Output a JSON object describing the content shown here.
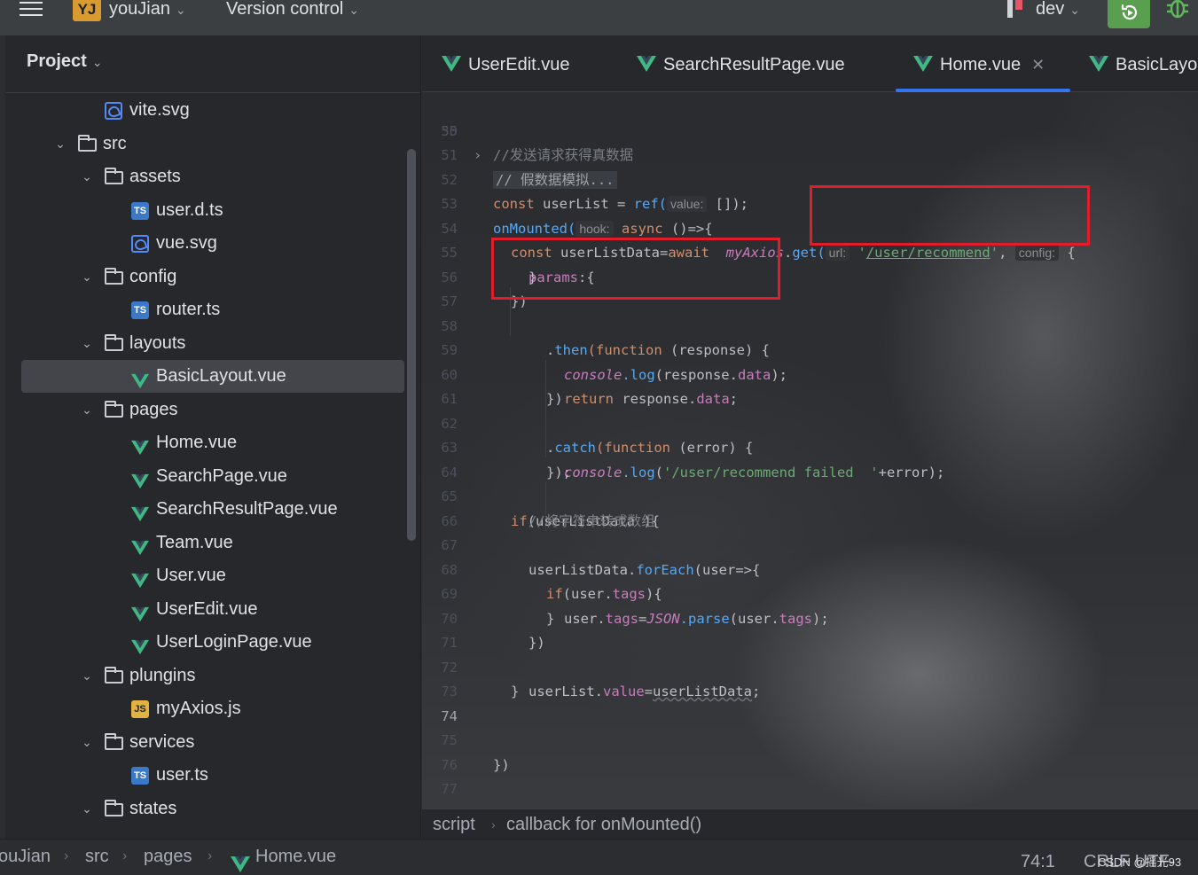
{
  "titlebar": {
    "project_badge": "YJ",
    "project_name": "youJian",
    "vcs_label": "Version control",
    "branch": "dev"
  },
  "project_panel": {
    "title": "Project",
    "items": [
      {
        "label": "vite.svg",
        "type": "svg"
      },
      {
        "label": "src",
        "type": "folder"
      },
      {
        "label": "assets",
        "type": "folder"
      },
      {
        "label": "user.d.ts",
        "type": "ts"
      },
      {
        "label": "vue.svg",
        "type": "svg"
      },
      {
        "label": "config",
        "type": "folder"
      },
      {
        "label": "router.ts",
        "type": "ts"
      },
      {
        "label": "layouts",
        "type": "folder"
      },
      {
        "label": "BasicLayout.vue",
        "type": "vue"
      },
      {
        "label": "pages",
        "type": "folder"
      },
      {
        "label": "Home.vue",
        "type": "vue"
      },
      {
        "label": "SearchPage.vue",
        "type": "vue"
      },
      {
        "label": "SearchResultPage.vue",
        "type": "vue"
      },
      {
        "label": "Team.vue",
        "type": "vue"
      },
      {
        "label": "User.vue",
        "type": "vue"
      },
      {
        "label": "UserEdit.vue",
        "type": "vue"
      },
      {
        "label": "UserLoginPage.vue",
        "type": "vue"
      },
      {
        "label": "plungins",
        "type": "folder"
      },
      {
        "label": "myAxios.js",
        "type": "js"
      },
      {
        "label": "services",
        "type": "folder"
      },
      {
        "label": "user.ts",
        "type": "ts"
      },
      {
        "label": "states",
        "type": "folder"
      }
    ]
  },
  "tabs": [
    {
      "label": "UserEdit.vue"
    },
    {
      "label": "SearchResultPage.vue"
    },
    {
      "label": "Home.vue"
    },
    {
      "label": "BasicLayo"
    }
  ],
  "code": {
    "line_numbers": [
      "35",
      "50",
      "51",
      "52",
      "53",
      "54",
      "55",
      "56",
      "57",
      "58",
      "59",
      "60",
      "61",
      "62",
      "63",
      "64",
      "65",
      "66",
      "67",
      "68",
      "69",
      "70",
      "71",
      "72",
      "73",
      "74",
      "75",
      "76",
      "77"
    ],
    "l35": "// 假数据模拟...",
    "l51": "//发送请求获得真数据",
    "l52_const": "const ",
    "l52_var": "userList = ",
    "l52_fn": "ref(",
    "l52_hint": "value:",
    "l52_rest": " []);",
    "l53_fn": "onMounted(",
    "l53_hint": "hook:",
    "l53_kw": " async",
    "l53_rest": " ()=>{",
    "l54_kw": "const ",
    "l54_var": "userListData=",
    "l54_await": "await ",
    "l54_obj": " myAxios",
    "l54_dot": ".",
    "l54_fn": "get(",
    "l54_hint_url": "url:",
    "l54_q1": " '",
    "l54_str": "/user/recommend",
    "l54_q2": "'",
    "l54_comma": ", ",
    "l54_hint_cfg": "config:",
    "l54_rest": " {",
    "l55_prop": "params",
    "l55_rest": ":{",
    "l56": "}",
    "l57": "})",
    "l58_dot": ".",
    "l58_fn": "then",
    "l58_kw": "(function",
    "l58_rest": " (response) {",
    "l59_obj": "console",
    "l59_fn": ".log",
    "l59_mid": "(response.",
    "l59_prop": "data",
    "l59_rest": ");",
    "l60_kw": "return ",
    "l60_mid": "response.",
    "l60_prop": "data",
    "l60_rest": ";",
    "l61": "})",
    "l62_dot": ".",
    "l62_fn": "catch",
    "l62_kw": "(function",
    "l62_rest": " (error) {",
    "l63_obj": "console",
    "l63_fn": ".log",
    "l63_open": "(",
    "l63_str": "'/user/recommend failed  '",
    "l63_rest": "+error);",
    "l64": "});",
    "l65_kw": "if",
    "l65_rest": "(userListData ){",
    "l66": "//将字符串转成数组",
    "l67_var": "userListData.",
    "l67_fn": "forEach",
    "l67_rest": "(user=>{",
    "l68_kw": "if",
    "l68_mid": "(user.",
    "l68_prop": "tags",
    "l68_rest": "){",
    "l69_var": "user.",
    "l69_prop": "tags",
    "l69_eq": "=",
    "l69_json": "JSON",
    "l69_fn": ".parse",
    "l69_mid": "(user.",
    "l69_prop2": "tags",
    "l69_rest": ");",
    "l70": "}",
    "l71": "})",
    "l72_var": "userList.",
    "l72_prop": "value",
    "l72_eq": "=",
    "l72_rhs": "userListData",
    "l72_rest": ";",
    "l73": "}",
    "l76": "})"
  },
  "editor_breadcrumb": {
    "first": "script",
    "sep": "›",
    "second": "callback for onMounted()"
  },
  "statusbar": {
    "path": [
      "ouJian",
      "src",
      "pages",
      "Home.vue"
    ],
    "sep": "›",
    "position": "74:1",
    "encoding": "CRLF  UTF-",
    "watermark": "CSDN @摇光93"
  },
  "colors": {
    "accent": "#3574f0",
    "highlight_box": "#e11d2b",
    "vue_green": "#41b883"
  }
}
